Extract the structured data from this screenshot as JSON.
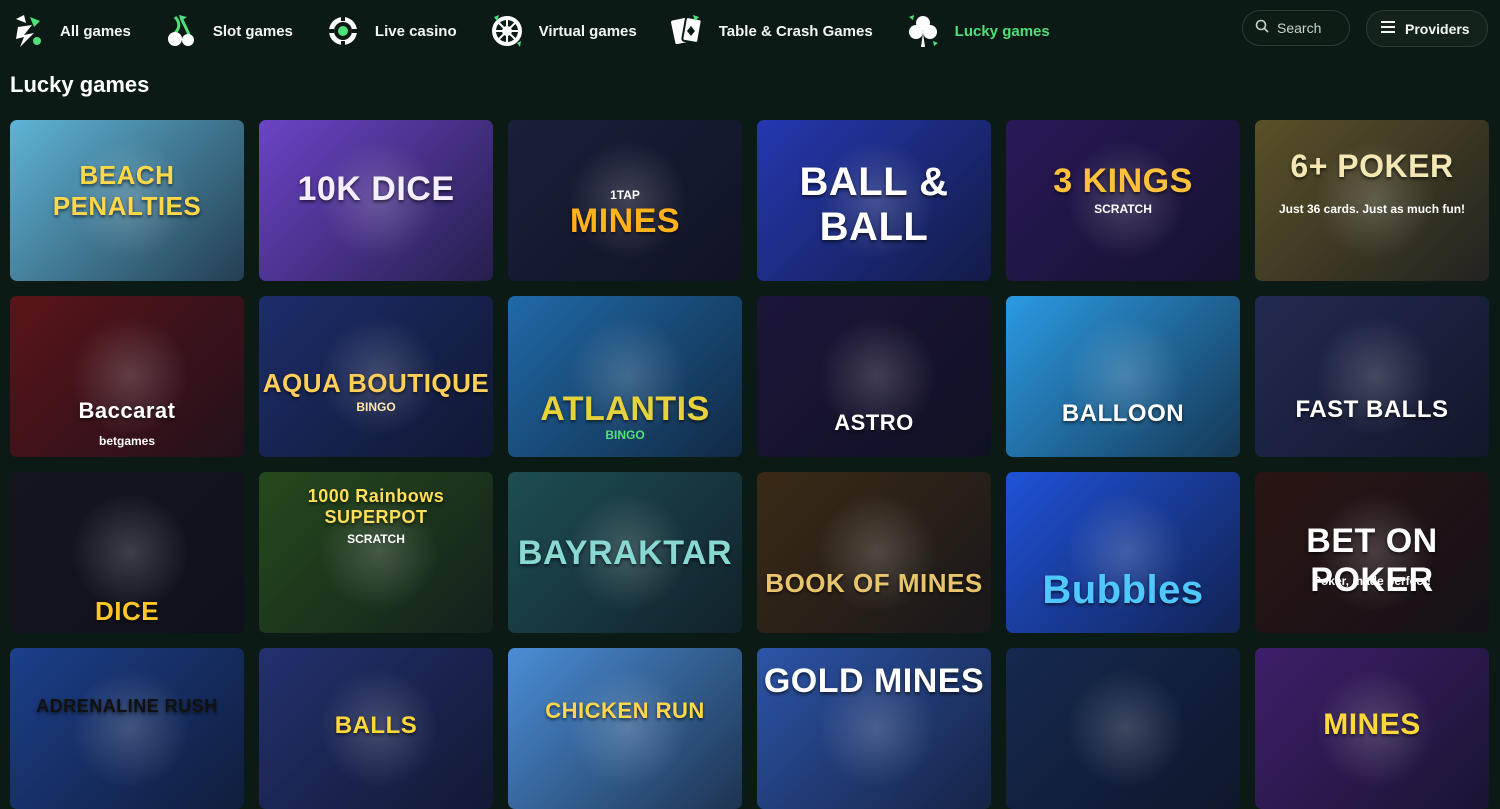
{
  "nav": {
    "items": [
      {
        "label": "All games",
        "icon": "all-games-icon"
      },
      {
        "label": "Slot games",
        "icon": "cherries-icon"
      },
      {
        "label": "Live casino",
        "icon": "chip-icon"
      },
      {
        "label": "Virtual games",
        "icon": "virtual-wheel-icon"
      },
      {
        "label": "Table & Crash Games",
        "icon": "cards-icon"
      },
      {
        "label": "Lucky games",
        "icon": "clover-icon"
      }
    ],
    "active_index": 5,
    "active_color": "#4ee07a"
  },
  "search": {
    "label": "Search",
    "icon": "search-icon"
  },
  "providers": {
    "label": "Providers",
    "icon": "menu-icon"
  },
  "section": {
    "title": "Lucky games"
  },
  "games": [
    {
      "title": "BEACH PENALTIES",
      "sub": "",
      "bg": "#5fb4d6"
    },
    {
      "title": "10K DICE",
      "sub": "",
      "bg": "#6a44c6"
    },
    {
      "title": "MINES",
      "sub": "1TAP",
      "bg": "#1a1f3a"
    },
    {
      "title": "BALL & BALL",
      "sub": "",
      "bg": "#2438b0"
    },
    {
      "title": "3 KINGS",
      "sub": "SCRATCH",
      "bg": "#2a1858"
    },
    {
      "title": "6+ POKER",
      "sub": "Just 36 cards. Just as much fun!",
      "bg": "#5a5128"
    },
    {
      "title": "Baccarat",
      "sub": "betgames",
      "bg": "#5a1418"
    },
    {
      "title": "AQUA BOUTIQUE",
      "sub": "BINGO",
      "bg": "#1c2d6a"
    },
    {
      "title": "ATLANTIS",
      "sub": "BINGO",
      "bg": "#1f6aa8"
    },
    {
      "title": "ASTRO",
      "sub": "",
      "bg": "#1c1538"
    },
    {
      "title": "BALLOON",
      "sub": "",
      "bg": "#2b9be3"
    },
    {
      "title": "FAST BALLS",
      "sub": "",
      "bg": "#232a50"
    },
    {
      "title": "DICE",
      "sub": "",
      "bg": "#15151d"
    },
    {
      "title": "1000 Rainbows SUPERPOT",
      "sub": "SCRATCH",
      "bg": "#254a1c"
    },
    {
      "title": "BAYRAKTAR",
      "sub": "",
      "bg": "#1d4e52"
    },
    {
      "title": "BOOK OF MINES",
      "sub": "",
      "bg": "#3a2a15"
    },
    {
      "title": "Bubbles",
      "sub": "",
      "bg": "#1f52d8"
    },
    {
      "title": "BET ON POKER",
      "sub": "Poker, made perfect!",
      "bg": "#2a1512"
    },
    {
      "title": "ADRENALINE RUSH",
      "sub": "",
      "bg": "#1b3f8a"
    },
    {
      "title": "BALLS",
      "sub": "",
      "bg": "#23306e"
    },
    {
      "title": "CHICKEN RUN",
      "sub": "",
      "bg": "#4a8ed6"
    },
    {
      "title": "GOLD MINES",
      "sub": "",
      "bg": "#2c54a8"
    },
    {
      "title": "",
      "sub": "",
      "bg": "#15294f"
    },
    {
      "title": "MINES",
      "sub": "",
      "bg": "#3e1f6a"
    }
  ]
}
